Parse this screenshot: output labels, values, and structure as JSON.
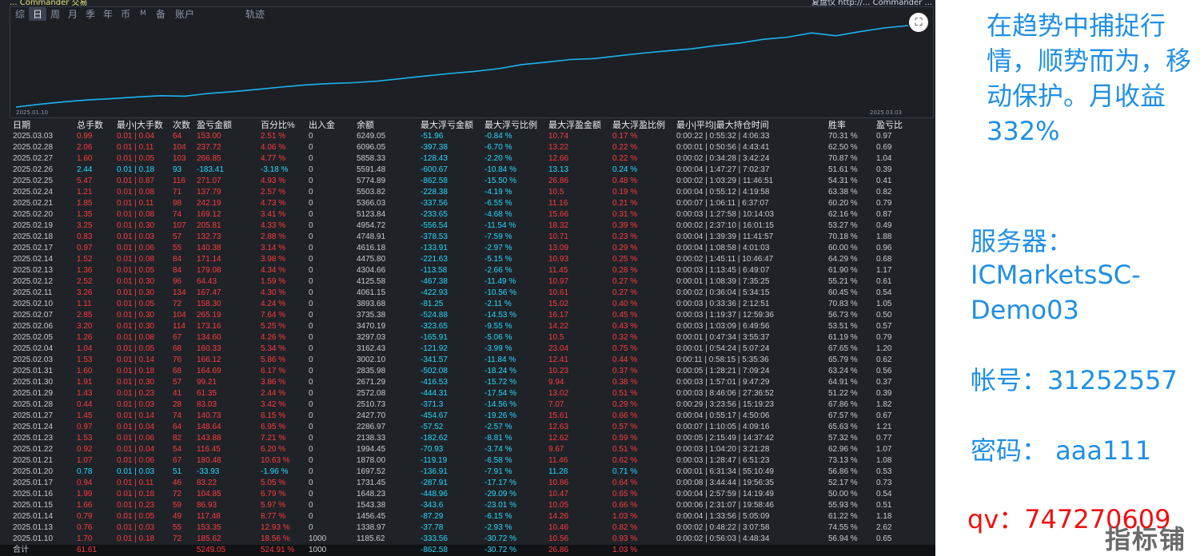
{
  "header": {
    "left_text": "... Commander 交易",
    "right_text": "复盘仪 http://... Commander ..."
  },
  "tabs": [
    "综",
    "日",
    "周",
    "月",
    "季",
    "年",
    "币",
    "M",
    "备",
    "账户",
    "轨迹"
  ],
  "active_tab": "日",
  "chart": {
    "start_date": "2025.01.10",
    "end_date": "2025.03.03",
    "line_color": "#1cb4f0"
  },
  "columns": [
    "日期",
    "总手数",
    "最小|大手数",
    "次数",
    "盈亏金额",
    "百分比%",
    "出入金",
    "余额",
    "最大浮亏金额",
    "最大浮亏比例",
    "最大浮盈金额",
    "最大浮盈比例",
    "最小|平均|最大持仓时间",
    "胜率",
    "盈亏比"
  ],
  "rows": [
    [
      "2025.03.03",
      "0.99",
      "0.01 | 0.04",
      "64",
      "153.00",
      "2.51 %",
      "0",
      "6249.05",
      "-51.96",
      "-0.84 %",
      "10.74",
      "0.17 %",
      "0:00:22 | 0:55:32 | 4:06:33",
      "70.31 %",
      "0.97"
    ],
    [
      "2025.02.28",
      "2.06",
      "0.01 | 0.11",
      "104",
      "237.72",
      "4.06 %",
      "0",
      "6096.05",
      "-397.38",
      "-6.70 %",
      "13.22",
      "0.22 %",
      "0:00:01 | 0:50:56 | 4:43:41",
      "62.50 %",
      "0.69"
    ],
    [
      "2025.02.27",
      "1.60",
      "0.01 | 0.05",
      "103",
      "266.85",
      "4.77 %",
      "0",
      "5858.33",
      "-128.43",
      "-2.20 %",
      "12.66",
      "0.22 %",
      "0:00:02 | 0:34:28 | 3:42:24",
      "70.87 %",
      "1.04"
    ],
    [
      "2025.02.26",
      "2.44",
      "0.01 | 0.18",
      "93",
      "-183.41",
      "-3.18 %",
      "0",
      "5591.48",
      "-600.67",
      "-10.84 %",
      "13.13",
      "0.24 %",
      "0:00:04 | 1:47:27 | 7:02:37",
      "51.61 %",
      "0.39"
    ],
    [
      "2025.02.25",
      "5.47",
      "0.01 | 0.87",
      "116",
      "271.07",
      "4.93 %",
      "0",
      "5774.89",
      "-862.58",
      "-15.50 %",
      "26.86",
      "0.48 %",
      "0:00:02 | 1:03:29 | 11:46:51",
      "54.31 %",
      "0.41"
    ],
    [
      "2025.02.24",
      "1.21",
      "0.01 | 0.08",
      "71",
      "137.79",
      "2.57 %",
      "0",
      "5503.82",
      "-228.38",
      "-4.19 %",
      "10.5",
      "0.19 %",
      "0:00:04 | 0:55:12 | 4:19:58",
      "63.38 %",
      "0.82"
    ],
    [
      "2025.02.21",
      "1.85",
      "0.01 | 0.11",
      "98",
      "242.19",
      "4.73 %",
      "0",
      "5366.03",
      "-337.56",
      "-6.55 %",
      "11.16",
      "0.21 %",
      "0:00:07 | 1:06:11 | 6:37:07",
      "60.20 %",
      "0.79"
    ],
    [
      "2025.02.20",
      "1.35",
      "0.01 | 0.08",
      "74",
      "169.12",
      "3.41 %",
      "0",
      "5123.84",
      "-233.65",
      "-4.68 %",
      "15.66",
      "0.31 %",
      "0:00:03 | 1:27:58 | 10:14:03",
      "62.16 %",
      "0.87"
    ],
    [
      "2025.02.19",
      "3.25",
      "0.01 | 0.30",
      "107",
      "205.81",
      "4.33 %",
      "0",
      "4954.72",
      "-556.54",
      "-11.54 %",
      "18.32",
      "0.39 %",
      "0:00:02 | 2:37:10 | 16:01:15",
      "53.27 %",
      "0.49"
    ],
    [
      "2025.02.18",
      "0.83",
      "0.01 | 0.03",
      "57",
      "132.73",
      "2.88 %",
      "0",
      "4748.91",
      "-378.53",
      "-7.59 %",
      "10.71",
      "0.23 %",
      "0:00:04 | 1:39:39 | 11:41:57",
      "70.18 %",
      "1.88"
    ],
    [
      "2025.02.17",
      "0.97",
      "0.01 | 0.06",
      "55",
      "140.38",
      "3.14 %",
      "0",
      "4616.18",
      "-133.91",
      "-2.97 %",
      "13.09",
      "0.29 %",
      "0:00:04 | 1:08:58 | 4:01:03",
      "60.00 %",
      "0.96"
    ],
    [
      "2025.02.14",
      "1.52",
      "0.01 | 0.08",
      "84",
      "171.14",
      "3.98 %",
      "0",
      "4475.80",
      "-221.63",
      "-5.15 %",
      "10.93",
      "0.25 %",
      "0:00:02 | 1:45:11 | 10:46:47",
      "64.29 %",
      "0.68"
    ],
    [
      "2025.02.13",
      "1.36",
      "0.01 | 0.05",
      "84",
      "179.08",
      "4.34 %",
      "0",
      "4304.66",
      "-113.58",
      "-2.66 %",
      "11.45",
      "0.28 %",
      "0:00:03 | 1:13:45 | 6:49:07",
      "61.90 %",
      "1.17"
    ],
    [
      "2025.02.12",
      "2.52",
      "0.01 | 0.30",
      "96",
      "64.43",
      "1.59 %",
      "0",
      "4125.58",
      "-467.38",
      "-11.49 %",
      "10.97",
      "0.27 %",
      "0:00:01 | 1:08:39 | 7:35:25",
      "55.21 %",
      "0.61"
    ],
    [
      "2025.02.11",
      "3.26",
      "0.01 | 0.30",
      "134",
      "167.47",
      "4.30 %",
      "0",
      "4061.15",
      "-422.93",
      "-10.56 %",
      "10.61",
      "0.27 %",
      "0:00:02 | 0:36:04 | 5:34:15",
      "60.45 %",
      "0.54"
    ],
    [
      "2025.02.10",
      "1.11",
      "0.01 | 0.05",
      "72",
      "158.30",
      "4.24 %",
      "0",
      "3893.68",
      "-81.25",
      "-2.11 %",
      "15.02",
      "0.40 %",
      "0:00:03 | 0:33:36 | 2:12:51",
      "70.83 %",
      "1.05"
    ],
    [
      "2025.02.07",
      "2.85",
      "0.01 | 0.30",
      "104",
      "265.19",
      "7.64 %",
      "0",
      "3735.38",
      "-524.88",
      "-14.53 %",
      "16.17",
      "0.45 %",
      "0:00:03 | 1:19:37 | 12:59:36",
      "56.73 %",
      "0.50"
    ],
    [
      "2025.02.06",
      "3.20",
      "0.01 | 0.30",
      "114",
      "173.16",
      "5.25 %",
      "0",
      "3470.19",
      "-323.65",
      "-9.55 %",
      "14.22",
      "0.43 %",
      "0:00:03 | 1:03:09 | 6:49:56",
      "53.51 %",
      "0.57"
    ],
    [
      "2025.02.05",
      "1.26",
      "0.01 | 0.08",
      "67",
      "134.60",
      "4.26 %",
      "0",
      "3297.03",
      "-165.91",
      "-5.06 %",
      "10.5",
      "0.32 %",
      "0:00:01 | 0:47:34 | 3:55:37",
      "61.19 %",
      "0.79"
    ],
    [
      "2025.02.04",
      "1.04",
      "0.01 | 0.05",
      "68",
      "160.33",
      "5.34 %",
      "0",
      "3162.43",
      "-121.92",
      "-3.99 %",
      "23.04",
      "0.75 %",
      "0:00:01 | 0:54:24 | 5:07:24",
      "67.65 %",
      "1.20"
    ],
    [
      "2025.02.03",
      "1.53",
      "0.01 | 0.14",
      "76",
      "166.12",
      "5.86 %",
      "0",
      "3002.10",
      "-341.57",
      "-11.84 %",
      "12.41",
      "0.44 %",
      "0:00:11 | 0:58:15 | 5:35:36",
      "65.79 %",
      "0.62"
    ],
    [
      "2025.01.31",
      "1.60",
      "0.01 | 0.18",
      "68",
      "164.69",
      "6.17 %",
      "0",
      "2835.98",
      "-502.08",
      "-18.24 %",
      "10.23",
      "0.37 %",
      "0:00:05 | 1:28:21 | 7:09:24",
      "63.24 %",
      "0.56"
    ],
    [
      "2025.01.30",
      "1.91",
      "0.01 | 0.30",
      "57",
      "99.21",
      "3.86 %",
      "0",
      "2671.29",
      "-416.53",
      "-15.72 %",
      "9.94",
      "0.38 %",
      "0:00:03 | 1:57:01 | 9:47:29",
      "64.91 %",
      "0.37"
    ],
    [
      "2025.01.29",
      "1.43",
      "0.01 | 0.23",
      "41",
      "61.35",
      "2.44 %",
      "0",
      "2572.08",
      "-444.31",
      "-17.54 %",
      "13.02",
      "0.51 %",
      "0:00:03 | 8:46:06 | 27:36:52",
      "51.22 %",
      "0.39"
    ],
    [
      "2025.01.28",
      "0.44",
      "0.01 | 0.03",
      "28",
      "83.03",
      "3.42 %",
      "0",
      "2510.73",
      "-371.3",
      "-14.56 %",
      "7.07",
      "0.29 %",
      "0:00:29 | 3:23:56 | 15:19:23",
      "67.86 %",
      "1.82"
    ],
    [
      "2025.01.27",
      "1.45",
      "0.01 | 0.14",
      "74",
      "140.73",
      "6.15 %",
      "0",
      "2427.70",
      "-454.67",
      "-19.26 %",
      "15.61",
      "0.66 %",
      "0:00:04 | 0:55:17 | 4:50:06",
      "67.57 %",
      "0.67"
    ],
    [
      "2025.01.24",
      "0.97",
      "0.01 | 0.04",
      "64",
      "148.64",
      "6.95 %",
      "0",
      "2286.97",
      "-57.52",
      "-2.57 %",
      "12.63",
      "0.57 %",
      "0:00:07 | 1:10:05 | 4:09:16",
      "65.63 %",
      "1.21"
    ],
    [
      "2025.01.23",
      "1.53",
      "0.01 | 0.06",
      "82",
      "143.88",
      "7.21 %",
      "0",
      "2138.33",
      "-182.62",
      "-8.81 %",
      "12.62",
      "0.59 %",
      "0:00:05 | 2:15:49 | 14:37:42",
      "57.32 %",
      "0.77"
    ],
    [
      "2025.01.22",
      "0.92",
      "0.01 | 0.04",
      "54",
      "116.45",
      "6.20 %",
      "0",
      "1994.45",
      "-70.93",
      "-3.74 %",
      "9.67",
      "0.51 %",
      "0:00:03 | 1:04:20 | 3:21:28",
      "62.96 %",
      "1.07"
    ],
    [
      "2025.01.21",
      "1.07",
      "0.01 | 0.06",
      "67",
      "180.48",
      "10.63 %",
      "0",
      "1878.00",
      "-119.19",
      "-6.58 %",
      "11.46",
      "0.62 %",
      "0:00:03 | 1:28:47 | 6:51:23",
      "73.13 %",
      "1.08"
    ],
    [
      "2025.01.20",
      "0.78",
      "0.01 | 0.03",
      "51",
      "-33.93",
      "-1.96 %",
      "0",
      "1697.52",
      "-136.91",
      "-7.91 %",
      "11.28",
      "0.71 %",
      "0:00:01 | 6:31:34 | 55:10:49",
      "56.86 %",
      "0.53"
    ],
    [
      "2025.01.17",
      "0.94",
      "0.01 | 0.11",
      "46",
      "83.22",
      "5.05 %",
      "0",
      "1731.45",
      "-287.91",
      "-17.17 %",
      "10.86",
      "0.64 %",
      "0:00:08 | 3:44:44 | 19:56:35",
      "52.17 %",
      "0.73"
    ],
    [
      "2025.01.16",
      "1.99",
      "0.01 | 0.18",
      "72",
      "104.85",
      "6.79 %",
      "0",
      "1648.23",
      "-448.96",
      "-29.09 %",
      "10.47",
      "0.65 %",
      "0:00:04 | 2:57:59 | 14:19:49",
      "50.00 %",
      "0.54"
    ],
    [
      "2025.01.15",
      "1.66",
      "0.01 | 0.23",
      "59",
      "86.93",
      "5.97 %",
      "0",
      "1543.38",
      "-343.6",
      "-23.01 %",
      "10.05",
      "0.66 %",
      "0:00:06 | 2:31:07 | 19:58:46",
      "55.93 %",
      "0.51"
    ],
    [
      "2025.01.14",
      "0.79",
      "0.01 | 0.05",
      "49",
      "117.48",
      "8.77 %",
      "0",
      "1456.45",
      "-87.29",
      "-6.15 %",
      "14.26",
      "1.03 %",
      "0:00:04 | 1:33:56 | 5:05:09",
      "61.22 %",
      "1.18"
    ],
    [
      "2025.01.13",
      "0.76",
      "0.01 | 0.03",
      "55",
      "153.35",
      "12.93 %",
      "0",
      "1338.97",
      "-37.78",
      "-2.93 %",
      "10.46",
      "0.82 %",
      "0:00:02 | 0:48:22 | 3:07:58",
      "74.55 %",
      "2.62"
    ],
    [
      "2025.01.10",
      "1.70",
      "0.01 | 0.18",
      "72",
      "185.62",
      "18.56 %",
      "1000",
      "1185.62",
      "-333.56",
      "-30.72 %",
      "10.56",
      "0.93 %",
      "0:00:02 | 0:56:03 | 4:48:34",
      "56.94 %",
      "0.65"
    ]
  ],
  "total_row": [
    "合计",
    "61.61",
    "",
    "",
    "5249.05",
    "524.91 %",
    "1000",
    "",
    "-862.58",
    "-30.72 %",
    "26.86",
    "1.03 %",
    "",
    "",
    ""
  ],
  "promo": {
    "title": "在趋势中捕捉行情，顺势而为，移动保护。月收益332%",
    "server_label": "服务器：",
    "server_value": "ICMarketsSC-Demo03",
    "account": "帐号：31252557",
    "password": "密码： aaa111",
    "qq": "qv：747270609",
    "watermark": "指标铺"
  }
}
